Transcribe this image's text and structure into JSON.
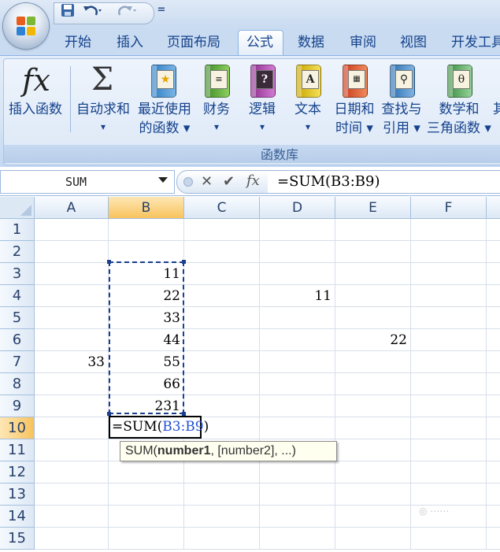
{
  "qat": {
    "dropdown_glyph": "="
  },
  "tabs": [
    "开始",
    "插入",
    "页面布局",
    "公式",
    "数据",
    "审阅",
    "视图",
    "开发工具"
  ],
  "active_tab": "公式",
  "ribbon": {
    "group_label": "函数库",
    "insert_function": "插入函数",
    "autosum": [
      "自动求和",
      "▾"
    ],
    "recent": [
      "最近使用",
      "的函数 ▾"
    ],
    "financial": [
      "财务",
      "▾"
    ],
    "logical": [
      "逻辑",
      "▾"
    ],
    "text": [
      "文本",
      "▾"
    ],
    "datetime": [
      "日期和",
      "时间 ▾"
    ],
    "lookup": [
      "查找与",
      "引用 ▾"
    ],
    "math": [
      "数学和",
      "三角函数 ▾"
    ],
    "more_partial": "其"
  },
  "formula_bar": {
    "name_box": "SUM",
    "cancel": "✕",
    "enter": "✔",
    "fx": "fx",
    "formula": "=SUM(B3:B9)"
  },
  "sheet": {
    "columns": [
      "A",
      "B",
      "C",
      "D",
      "E",
      "F"
    ],
    "selected_column": "B",
    "rows": [
      "1",
      "2",
      "3",
      "4",
      "5",
      "6",
      "7",
      "8",
      "9",
      "10",
      "11",
      "12",
      "13",
      "14",
      "15"
    ],
    "selected_row": "10",
    "cells": {
      "B3": "11",
      "B4": "22",
      "B5": "33",
      "B6": "44",
      "B7": "55",
      "B8": "66",
      "B9": "231",
      "D4": "11",
      "E6": "22",
      "A7": "33"
    },
    "edit_cell": {
      "prefix": "=SUM(",
      "ref": "B3:B9",
      "suffix": ")"
    },
    "tooltip": {
      "fn": "SUM(",
      "bold_arg": "number1",
      "rest": ", [number2], ...)"
    }
  },
  "colors": {
    "accent": "#15428b",
    "selection": "#f8c35d",
    "ref_blue": "#1f4fd6"
  }
}
